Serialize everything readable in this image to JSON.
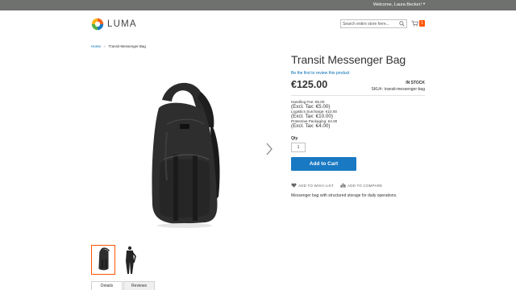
{
  "header": {
    "welcome_text": "Welcome, Laura Becker!",
    "brand_name": "LUMA",
    "search_placeholder": "Search entire store here...",
    "cart_count": "1"
  },
  "breadcrumb": {
    "home": "Home",
    "current": "Transit Messenger Bag"
  },
  "product": {
    "name": "Transit Messenger Bag",
    "review_prompt": "Be the first to review this product",
    "price": "€125.00",
    "stock_status": "In stock",
    "sku_label": "SKU#:",
    "sku_value": "transit-messenger-bag",
    "fees": [
      {
        "label": "Handling Fee: €5.00",
        "excl": "(Excl. Tax: €5.00)"
      },
      {
        "label": "Logistics Surcharge: €10.00",
        "excl": "(Excl. Tax: €10.00)"
      },
      {
        "label": "Protective Packaging: €4.00",
        "excl": "(Excl. Tax: €4.00)"
      }
    ],
    "qty_label": "Qty",
    "qty_value": "1",
    "add_to_cart_label": "Add to Cart",
    "wishlist_label": "Add to Wish List",
    "compare_label": "Add to Compare",
    "short_description": "Messenger bag with structured storage for daily operations."
  },
  "tabs": [
    "Details",
    "Reviews"
  ],
  "icons": {
    "logo": "luma-logo-icon",
    "search": "search-icon",
    "cart": "cart-icon",
    "next": "chevron-right-icon",
    "wishlist": "heart-icon",
    "compare": "compare-icon"
  },
  "colors": {
    "topbar": "#6e716e",
    "link": "#006bb4",
    "primary_button": "#1979c3",
    "accent": "#ff5501"
  }
}
